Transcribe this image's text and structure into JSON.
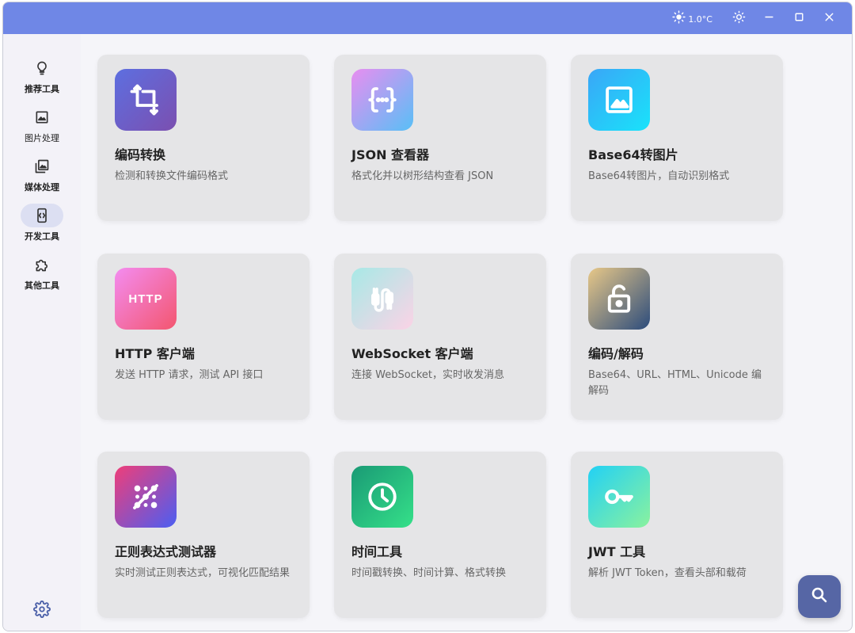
{
  "titlebar": {
    "temperature": "1.0°C",
    "icons": [
      "weather-sun-icon",
      "theme-toggle-icon",
      "minimize-icon",
      "maximize-icon",
      "close-icon"
    ],
    "color": "#6f87e6"
  },
  "sidebar": {
    "items": [
      {
        "label": "推荐工具",
        "icon": "lightbulb-icon"
      },
      {
        "label": "图片处理",
        "icon": "image-icon"
      },
      {
        "label": "媒体处理",
        "icon": "photo-library-icon"
      },
      {
        "label": "开发工具",
        "icon": "code-icon",
        "active": true
      },
      {
        "label": "其他工具",
        "icon": "puzzle-icon"
      }
    ],
    "settings_icon": "gear-icon"
  },
  "cards": [
    {
      "title": "编码转换",
      "desc": "检测和转换文件编码格式",
      "icon": "crop-transform-icon",
      "gradient": [
        "#5d6fe0",
        "#7b4fb0"
      ]
    },
    {
      "title": "JSON 查看器",
      "desc": "格式化并以树形结构查看 JSON",
      "icon": "curly-braces-icon",
      "gradient": [
        "#e88ef0",
        "#58bff6"
      ]
    },
    {
      "title": "Base64转图片",
      "desc": "Base64转图片，自动识别格式",
      "icon": "image-icon",
      "gradient": [
        "#3aa6f7",
        "#19e3fa"
      ]
    },
    {
      "title": "HTTP 客户端",
      "desc": "发送 HTTP 请求，测试 API 接口",
      "icon": "http-icon",
      "icon_text": "HTTP",
      "gradient": [
        "#f38cf0",
        "#f3566f"
      ]
    },
    {
      "title": "WebSocket 客户端",
      "desc": "连接 WebSocket，实时收发消息",
      "icon": "cable-icon",
      "gradient": [
        "#a7e9e6",
        "#fbd3e6"
      ]
    },
    {
      "title": "编码/解码",
      "desc": "Base64、URL、HTML、Unicode 编解码",
      "icon": "lock-open-icon",
      "gradient": [
        "#e8c888",
        "#2c4c7c"
      ]
    },
    {
      "title": "正则表达式测试器",
      "desc": "实时测试正则表达式，可视化匹配结果",
      "icon": "regex-icon",
      "gradient": [
        "#ef3e79",
        "#4b5ef2"
      ]
    },
    {
      "title": "时间工具",
      "desc": "时间戳转换、时间计算、格式转换",
      "icon": "clock-icon",
      "gradient": [
        "#1a9a75",
        "#35e089"
      ]
    },
    {
      "title": "JWT 工具",
      "desc": "解析 JWT Token，查看头部和载荷",
      "icon": "key-icon",
      "gradient": [
        "#22d1f5",
        "#8af29e"
      ]
    }
  ],
  "fab": {
    "icon": "search-icon",
    "color": "#5666a5"
  }
}
